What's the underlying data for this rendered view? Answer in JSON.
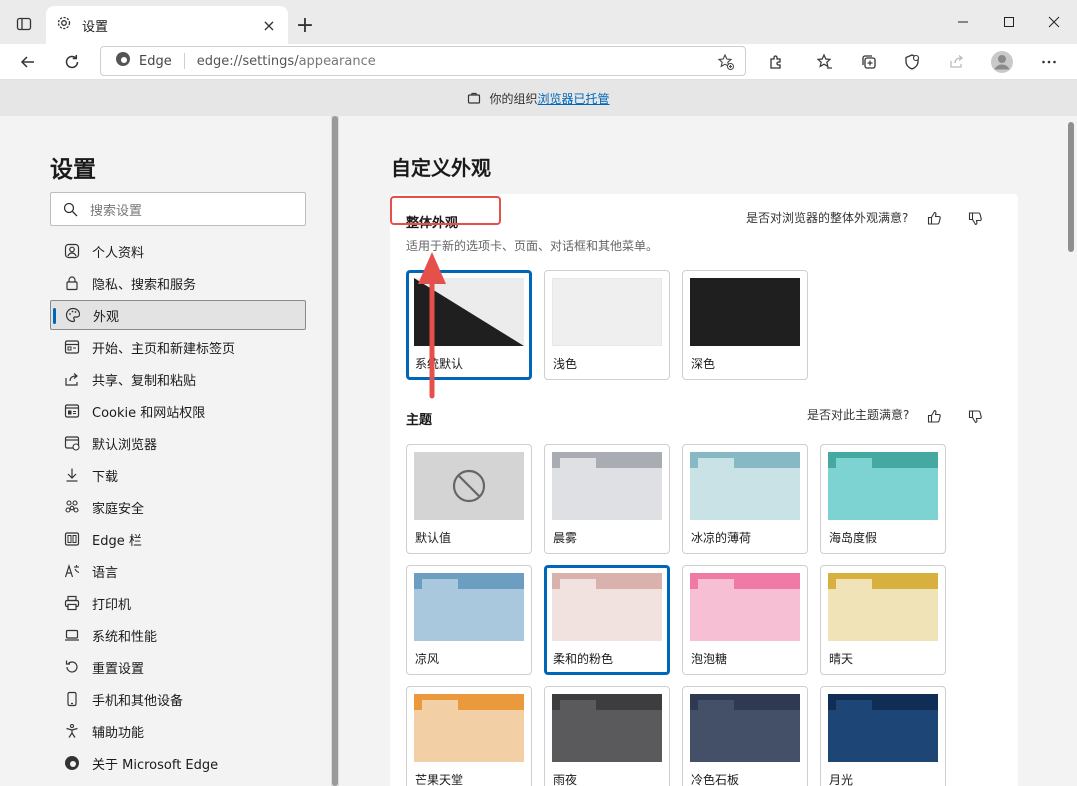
{
  "tab": {
    "title": "设置",
    "close": "×",
    "new": "+"
  },
  "address": {
    "brand": "Edge",
    "host": "edge://settings/",
    "path": "appearance"
  },
  "managed": {
    "prefix": "你的组织",
    "link": "浏览器已托管"
  },
  "sidebar": {
    "title": "设置",
    "search_placeholder": "搜索设置",
    "items": [
      {
        "label": "个人资料",
        "icon": "profile-icon"
      },
      {
        "label": "隐私、搜索和服务",
        "icon": "lock-icon"
      },
      {
        "label": "外观",
        "icon": "palette-icon",
        "active": true
      },
      {
        "label": "开始、主页和新建标签页",
        "icon": "home-page-icon"
      },
      {
        "label": "共享、复制和粘贴",
        "icon": "share-icon"
      },
      {
        "label": "Cookie 和网站权限",
        "icon": "site-permissions-icon"
      },
      {
        "label": "默认浏览器",
        "icon": "default-browser-icon"
      },
      {
        "label": "下载",
        "icon": "download-icon"
      },
      {
        "label": "家庭安全",
        "icon": "family-icon"
      },
      {
        "label": "Edge 栏",
        "icon": "edge-bar-icon"
      },
      {
        "label": "语言",
        "icon": "language-icon"
      },
      {
        "label": "打印机",
        "icon": "printer-icon"
      },
      {
        "label": "系统和性能",
        "icon": "laptop-icon"
      },
      {
        "label": "重置设置",
        "icon": "reset-icon"
      },
      {
        "label": "手机和其他设备",
        "icon": "phone-icon"
      },
      {
        "label": "辅助功能",
        "icon": "accessibility-icon"
      },
      {
        "label": "关于 Microsoft Edge",
        "icon": "edge-logo-icon"
      }
    ]
  },
  "main": {
    "title": "自定义外观",
    "overall": {
      "title": "整体外观",
      "desc": "适用于新的选项卡、页面、对话框和其他菜单。",
      "feedback": "是否对浏览器的整体外观满意?",
      "options": [
        {
          "label": "系统默认",
          "selected": true
        },
        {
          "label": "浅色"
        },
        {
          "label": "深色"
        }
      ]
    },
    "themes": {
      "title": "主题",
      "feedback": "是否对此主题满意?",
      "items": [
        {
          "label": "默认值",
          "tab": "#d4d4d4",
          "body": "#d4d4d4",
          "default": true
        },
        {
          "label": "晨雾",
          "tab": "#a9adb3",
          "body": "#dfe0e4"
        },
        {
          "label": "冰凉的薄荷",
          "tab": "#86b9c3",
          "body": "#c9e2e6"
        },
        {
          "label": "海岛度假",
          "tab": "#46a9a1",
          "body": "#7dd3d1"
        },
        {
          "label": "凉风",
          "tab": "#6c9ec2",
          "body": "#a9c7dd"
        },
        {
          "label": "柔和的粉色",
          "tab": "#d9b1ad",
          "body": "#f1e2e0",
          "selected": true
        },
        {
          "label": "泡泡糖",
          "tab": "#f07aa6",
          "body": "#f6bfd3"
        },
        {
          "label": "晴天",
          "tab": "#d8b03f",
          "body": "#f1e3b8"
        },
        {
          "label": "芒果天堂",
          "tab": "#ea9a3c",
          "body": "#f3cfa5"
        },
        {
          "label": "雨夜",
          "tab": "#3d3d3f",
          "body": "#5a5a5c"
        },
        {
          "label": "冷色石板",
          "tab": "#2f3a52",
          "body": "#435068"
        },
        {
          "label": "月光",
          "tab": "#0f2d55",
          "body": "#1d4677"
        }
      ]
    }
  }
}
